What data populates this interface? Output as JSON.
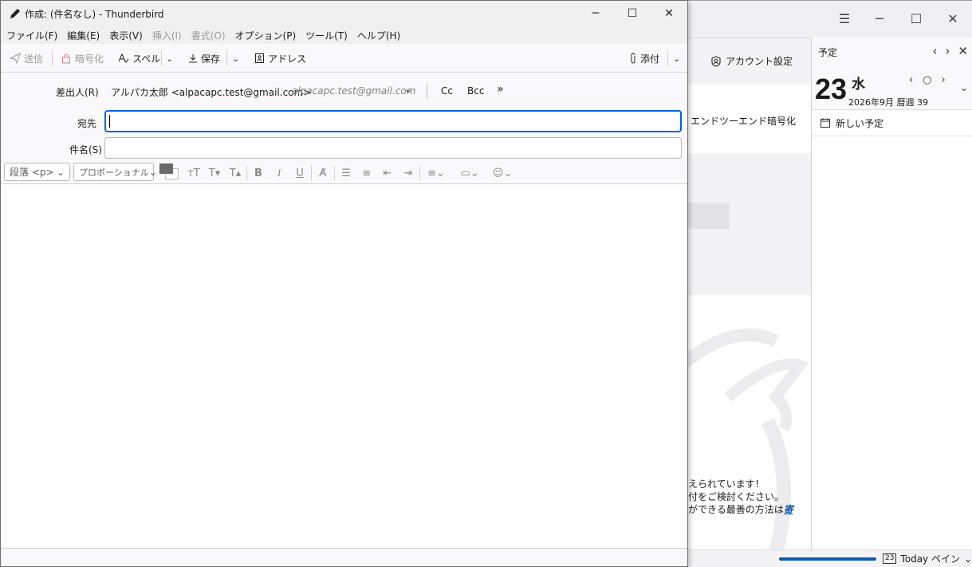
{
  "compose": {
    "title": "作成: (件名なし) - Thunderbird",
    "menu": [
      {
        "label": "ファイル(F)",
        "enabled": true
      },
      {
        "label": "編集(E)",
        "enabled": true
      },
      {
        "label": "表示(V)",
        "enabled": true
      },
      {
        "label": "挿入(I)",
        "enabled": false
      },
      {
        "label": "書式(O)",
        "enabled": false
      },
      {
        "label": "オプション(P)",
        "enabled": true
      },
      {
        "label": "ツール(T)",
        "enabled": true
      },
      {
        "label": "ヘルプ(H)",
        "enabled": true
      }
    ],
    "toolbar": {
      "send_label": "送信",
      "encrypt_label": "暗号化",
      "spell_label": "スペル",
      "save_label": "保存",
      "address_label": "アドレス",
      "attach_label": "添付"
    },
    "headers": {
      "from_label": "差出人(R)",
      "from_value": "アルパカ太郎 <alpacapc.test@gmail.com>",
      "from_alias": "alpacapc.test@gmail.com",
      "cc_label": "Cc",
      "bcc_label": "Bcc",
      "more_label": "»",
      "to_label": "宛先",
      "to_value": "",
      "subject_label": "件名(S)",
      "subject_value": ""
    },
    "format": {
      "paragraph_value": "段落 <p>",
      "font_value": "プロポーショナル"
    }
  },
  "main_window": {
    "account_settings_label": "アカウント設定",
    "e2e_label": "エンドツーエンド暗号化",
    "promo_lines": [
      "えられています！",
      "付をご検討ください。",
      "ができる最善の方法は"
    ],
    "promo_link": "寄",
    "today_pane_label": "Today ペイン",
    "progress_fraction": 1.0
  },
  "today_pane": {
    "title": "予定",
    "day": "23",
    "weekday": "水",
    "date_line": "2026年9月 暦週 39",
    "new_event_label": "新しい予定",
    "calendar_badge": "23"
  },
  "colors": {
    "accent": "#0061e0",
    "link": "#0b5cad"
  }
}
